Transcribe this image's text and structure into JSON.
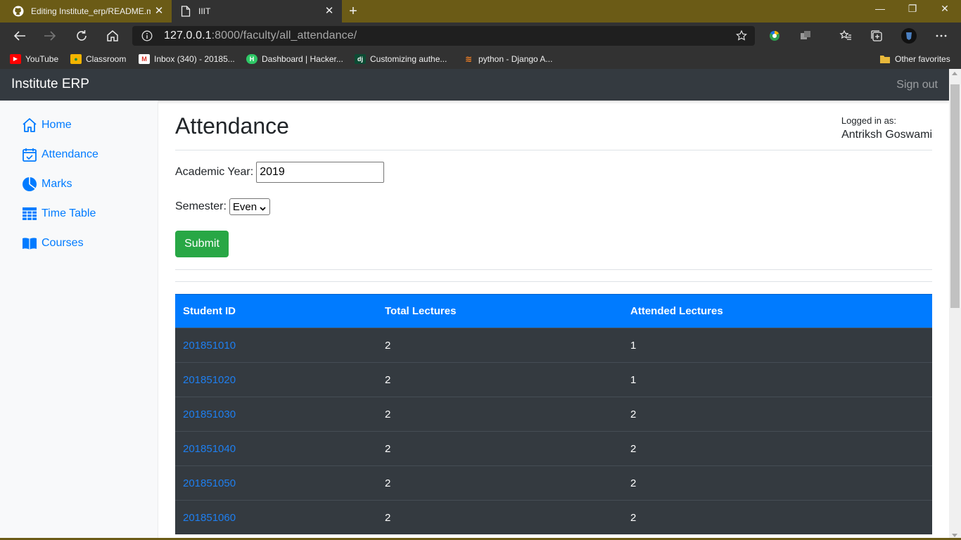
{
  "browser": {
    "tabs": [
      {
        "title": "Editing Institute_erp/README.md",
        "icon": "github-icon",
        "active": false
      },
      {
        "title": "IIIT",
        "icon": "page-icon",
        "active": true
      }
    ],
    "address": {
      "host": "127.0.0.1",
      "rest": ":8000/faculty/all_attendance/"
    },
    "bookmarks": [
      {
        "label": "YouTube",
        "icon": "youtube-icon",
        "color": "#ff0000"
      },
      {
        "label": "Classroom",
        "icon": "classroom-icon",
        "color": "#f4b400"
      },
      {
        "label": "Inbox (340) - 20185...",
        "icon": "gmail-icon",
        "color": "#d93025"
      },
      {
        "label": "Dashboard | Hacker...",
        "icon": "hackerrank-icon",
        "color": "#2ec866"
      },
      {
        "label": "Customizing authe...",
        "icon": "django-icon",
        "color": "#0c4b33"
      },
      {
        "label": "python - Django A...",
        "icon": "stackoverflow-icon",
        "color": "#f48024"
      },
      {
        "label": "Other favorites",
        "icon": "folder-icon",
        "color": "#e8b83b"
      }
    ]
  },
  "app": {
    "brand": "Institute ERP",
    "signout": "Sign out",
    "sidebar": [
      {
        "label": "Home",
        "icon": "home-icon"
      },
      {
        "label": "Attendance",
        "icon": "calendar-icon"
      },
      {
        "label": "Marks",
        "icon": "pie-chart-icon"
      },
      {
        "label": "Time Table",
        "icon": "table-icon"
      },
      {
        "label": "Courses",
        "icon": "book-icon"
      }
    ],
    "page_title": "Attendance",
    "logged_in_label": "Logged in as:",
    "logged_in_user": "Antriksh Goswami",
    "form": {
      "year_label": "Academic Year:",
      "year_value": "2019",
      "semester_label": "Semester:",
      "semester_value": "Even",
      "submit_label": "Submit"
    },
    "table": {
      "headers": [
        "Student ID",
        "Total Lectures",
        "Attended Lectures"
      ],
      "rows": [
        [
          "201851010",
          "2",
          "1"
        ],
        [
          "201851020",
          "2",
          "1"
        ],
        [
          "201851030",
          "2",
          "2"
        ],
        [
          "201851040",
          "2",
          "2"
        ],
        [
          "201851050",
          "2",
          "2"
        ],
        [
          "201851060",
          "2",
          "2"
        ]
      ]
    }
  },
  "colors": {
    "primary": "#007bff",
    "success": "#28a745",
    "dark": "#343a40",
    "chrome_title": "#6b5b16"
  }
}
